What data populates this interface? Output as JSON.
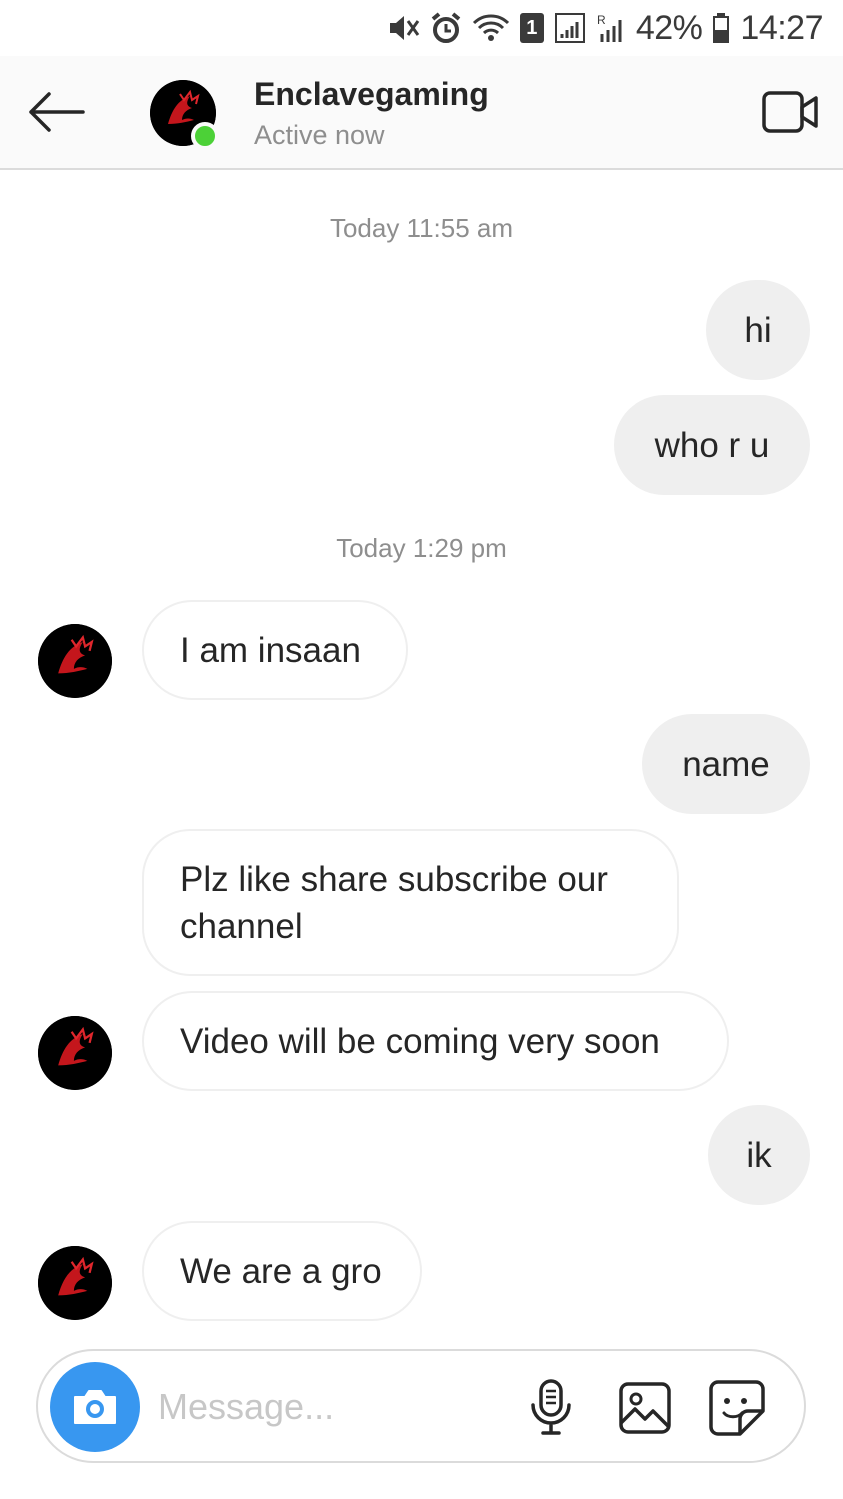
{
  "status_bar": {
    "battery_percent": "42%",
    "time": "14:27",
    "sim_number": "1",
    "icons": [
      "mute-vibrate-icon",
      "alarm-icon",
      "wifi-icon",
      "sim-badge-icon",
      "signal-icon",
      "roaming-signal-icon",
      "battery-icon"
    ]
  },
  "header": {
    "name": "Enclavegaming",
    "status": "Active now",
    "icons": [
      "back-arrow-icon",
      "dragon-avatar-icon",
      "video-call-icon"
    ],
    "online_color": "#4cd137"
  },
  "chat": {
    "timestamps": [
      "Today 11:55 am",
      "Today 1:29 pm"
    ],
    "messages": [
      {
        "from": "me",
        "text": "hi"
      },
      {
        "from": "me",
        "text": "who r u"
      },
      {
        "from": "them",
        "text": "I am insaan"
      },
      {
        "from": "me",
        "text": "name"
      },
      {
        "from": "them",
        "text": "Plz like share subscribe our channel"
      },
      {
        "from": "them",
        "text": "Video will be coming very soon"
      },
      {
        "from": "me",
        "text": "ik"
      },
      {
        "from": "them",
        "text": "We are a gro"
      }
    ]
  },
  "composer": {
    "placeholder": "Message...",
    "icons": [
      "camera-icon",
      "microphone-icon",
      "gallery-icon",
      "sticker-icon"
    ],
    "camera_color": "#3897f0"
  }
}
